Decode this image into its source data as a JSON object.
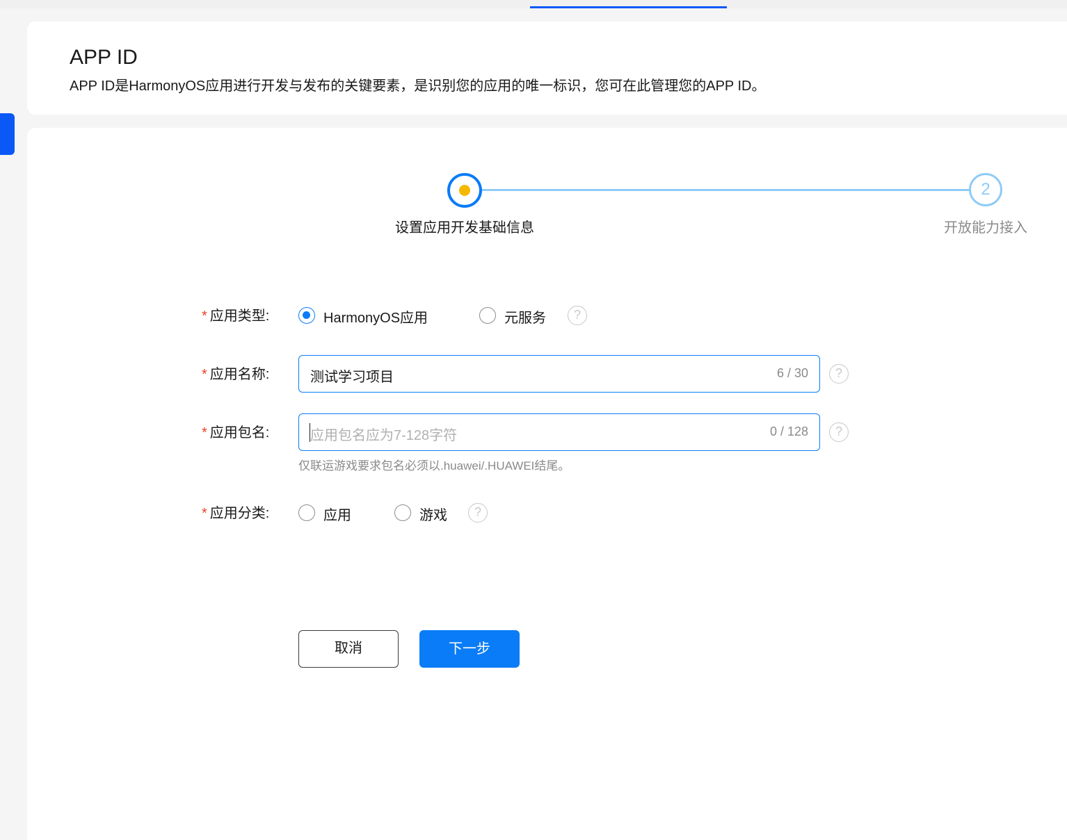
{
  "header": {
    "title": "APP ID",
    "description": "APP ID是HarmonyOS应用进行开发与发布的关键要素，是识别您的应用的唯一标识，您可在此管理您的APP ID。"
  },
  "steps": [
    {
      "label": "设置应用开发基础信息",
      "status": "current"
    },
    {
      "number": "2",
      "label": "开放能力接入",
      "status": "pending"
    }
  ],
  "form": {
    "app_type": {
      "label": "应用类型:",
      "options": [
        {
          "label": "HarmonyOS应用",
          "checked": true
        },
        {
          "label": "元服务",
          "checked": false
        }
      ]
    },
    "app_name": {
      "label": "应用名称:",
      "value": "测试学习项目",
      "counter": "6 / 30"
    },
    "package_name": {
      "label": "应用包名:",
      "placeholder": "应用包名应为7-128字符",
      "counter": "0 / 128",
      "hint": "仅联运游戏要求包名必须以.huawei/.HUAWEI结尾。"
    },
    "app_category": {
      "label": "应用分类:",
      "options": [
        {
          "label": "应用",
          "checked": false
        },
        {
          "label": "游戏",
          "checked": false
        }
      ]
    },
    "required_mark": "*",
    "help_glyph": "?"
  },
  "buttons": {
    "cancel": "取消",
    "next": "下一步"
  },
  "colors": {
    "primary": "#0a7cf7",
    "step_line": "#8ecbf7",
    "step_dot": "#f5b800",
    "required": "#e84026"
  },
  "icons": [
    "help-icon",
    "radio-icon"
  ]
}
